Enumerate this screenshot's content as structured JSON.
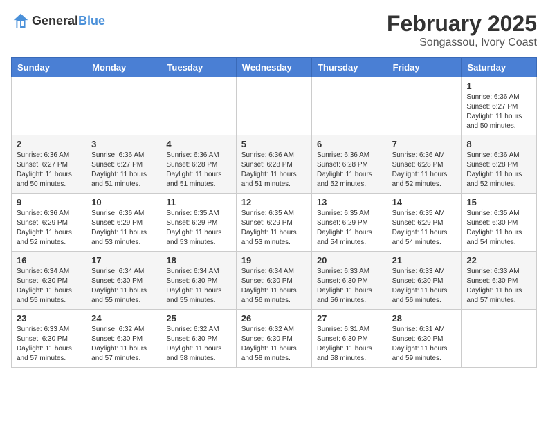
{
  "logo": {
    "text_general": "General",
    "text_blue": "Blue"
  },
  "title": {
    "month": "February 2025",
    "location": "Songassou, Ivory Coast"
  },
  "weekdays": [
    "Sunday",
    "Monday",
    "Tuesday",
    "Wednesday",
    "Thursday",
    "Friday",
    "Saturday"
  ],
  "weeks": [
    [
      {
        "day": "",
        "info": ""
      },
      {
        "day": "",
        "info": ""
      },
      {
        "day": "",
        "info": ""
      },
      {
        "day": "",
        "info": ""
      },
      {
        "day": "",
        "info": ""
      },
      {
        "day": "",
        "info": ""
      },
      {
        "day": "1",
        "info": "Sunrise: 6:36 AM\nSunset: 6:27 PM\nDaylight: 11 hours\nand 50 minutes."
      }
    ],
    [
      {
        "day": "2",
        "info": "Sunrise: 6:36 AM\nSunset: 6:27 PM\nDaylight: 11 hours\nand 50 minutes."
      },
      {
        "day": "3",
        "info": "Sunrise: 6:36 AM\nSunset: 6:27 PM\nDaylight: 11 hours\nand 51 minutes."
      },
      {
        "day": "4",
        "info": "Sunrise: 6:36 AM\nSunset: 6:28 PM\nDaylight: 11 hours\nand 51 minutes."
      },
      {
        "day": "5",
        "info": "Sunrise: 6:36 AM\nSunset: 6:28 PM\nDaylight: 11 hours\nand 51 minutes."
      },
      {
        "day": "6",
        "info": "Sunrise: 6:36 AM\nSunset: 6:28 PM\nDaylight: 11 hours\nand 52 minutes."
      },
      {
        "day": "7",
        "info": "Sunrise: 6:36 AM\nSunset: 6:28 PM\nDaylight: 11 hours\nand 52 minutes."
      },
      {
        "day": "8",
        "info": "Sunrise: 6:36 AM\nSunset: 6:28 PM\nDaylight: 11 hours\nand 52 minutes."
      }
    ],
    [
      {
        "day": "9",
        "info": "Sunrise: 6:36 AM\nSunset: 6:29 PM\nDaylight: 11 hours\nand 52 minutes."
      },
      {
        "day": "10",
        "info": "Sunrise: 6:36 AM\nSunset: 6:29 PM\nDaylight: 11 hours\nand 53 minutes."
      },
      {
        "day": "11",
        "info": "Sunrise: 6:35 AM\nSunset: 6:29 PM\nDaylight: 11 hours\nand 53 minutes."
      },
      {
        "day": "12",
        "info": "Sunrise: 6:35 AM\nSunset: 6:29 PM\nDaylight: 11 hours\nand 53 minutes."
      },
      {
        "day": "13",
        "info": "Sunrise: 6:35 AM\nSunset: 6:29 PM\nDaylight: 11 hours\nand 54 minutes."
      },
      {
        "day": "14",
        "info": "Sunrise: 6:35 AM\nSunset: 6:29 PM\nDaylight: 11 hours\nand 54 minutes."
      },
      {
        "day": "15",
        "info": "Sunrise: 6:35 AM\nSunset: 6:30 PM\nDaylight: 11 hours\nand 54 minutes."
      }
    ],
    [
      {
        "day": "16",
        "info": "Sunrise: 6:34 AM\nSunset: 6:30 PM\nDaylight: 11 hours\nand 55 minutes."
      },
      {
        "day": "17",
        "info": "Sunrise: 6:34 AM\nSunset: 6:30 PM\nDaylight: 11 hours\nand 55 minutes."
      },
      {
        "day": "18",
        "info": "Sunrise: 6:34 AM\nSunset: 6:30 PM\nDaylight: 11 hours\nand 55 minutes."
      },
      {
        "day": "19",
        "info": "Sunrise: 6:34 AM\nSunset: 6:30 PM\nDaylight: 11 hours\nand 56 minutes."
      },
      {
        "day": "20",
        "info": "Sunrise: 6:33 AM\nSunset: 6:30 PM\nDaylight: 11 hours\nand 56 minutes."
      },
      {
        "day": "21",
        "info": "Sunrise: 6:33 AM\nSunset: 6:30 PM\nDaylight: 11 hours\nand 56 minutes."
      },
      {
        "day": "22",
        "info": "Sunrise: 6:33 AM\nSunset: 6:30 PM\nDaylight: 11 hours\nand 57 minutes."
      }
    ],
    [
      {
        "day": "23",
        "info": "Sunrise: 6:33 AM\nSunset: 6:30 PM\nDaylight: 11 hours\nand 57 minutes."
      },
      {
        "day": "24",
        "info": "Sunrise: 6:32 AM\nSunset: 6:30 PM\nDaylight: 11 hours\nand 57 minutes."
      },
      {
        "day": "25",
        "info": "Sunrise: 6:32 AM\nSunset: 6:30 PM\nDaylight: 11 hours\nand 58 minutes."
      },
      {
        "day": "26",
        "info": "Sunrise: 6:32 AM\nSunset: 6:30 PM\nDaylight: 11 hours\nand 58 minutes."
      },
      {
        "day": "27",
        "info": "Sunrise: 6:31 AM\nSunset: 6:30 PM\nDaylight: 11 hours\nand 58 minutes."
      },
      {
        "day": "28",
        "info": "Sunrise: 6:31 AM\nSunset: 6:30 PM\nDaylight: 11 hours\nand 59 minutes."
      },
      {
        "day": "",
        "info": ""
      }
    ]
  ]
}
